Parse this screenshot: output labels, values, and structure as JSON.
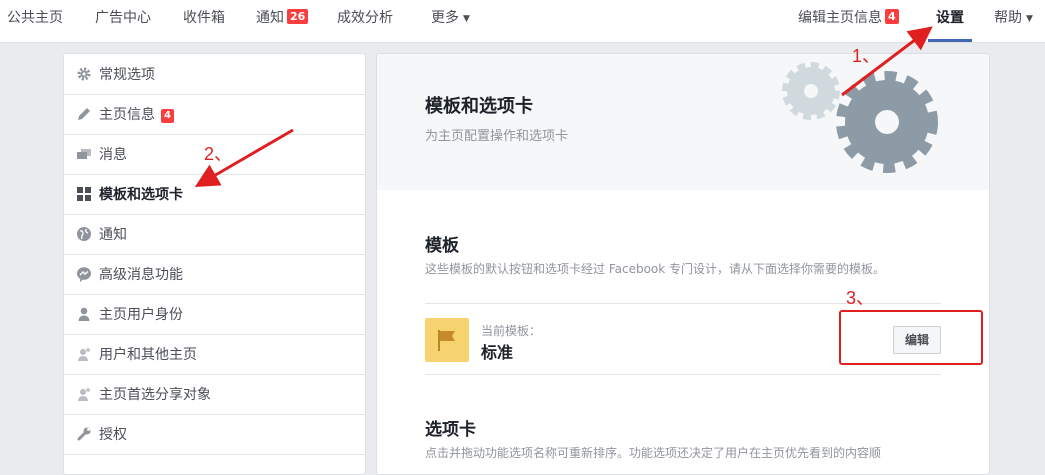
{
  "topnav": {
    "items": [
      {
        "label": "公共主页"
      },
      {
        "label": "广告中心"
      },
      {
        "label": "收件箱"
      },
      {
        "label": "通知",
        "badge": "26"
      },
      {
        "label": "成效分析"
      },
      {
        "label": "更多"
      }
    ],
    "right": [
      {
        "label": "编辑主页信息",
        "badge": "4"
      },
      {
        "label": "设置"
      },
      {
        "label": "帮助"
      }
    ],
    "active": "设置"
  },
  "sidebar": {
    "items": [
      {
        "label": "常规选项",
        "icon": "gear-icon"
      },
      {
        "label": "主页信息",
        "icon": "pencil-icon",
        "badge": "4"
      },
      {
        "label": "消息",
        "icon": "messages-icon"
      },
      {
        "label": "模板和选项卡",
        "icon": "grid-icon",
        "active": true
      },
      {
        "label": "通知",
        "icon": "globe-icon"
      },
      {
        "label": "高级消息功能",
        "icon": "messenger-icon"
      },
      {
        "label": "主页用户身份",
        "icon": "person-icon"
      },
      {
        "label": "用户和其他主页",
        "icon": "person-star-icon"
      },
      {
        "label": "主页首选分享对象",
        "icon": "person-star-icon"
      },
      {
        "label": "授权",
        "icon": "wrench-icon"
      }
    ]
  },
  "main": {
    "title": "模板和选项卡",
    "subtitle": "为主页配置操作和选项卡",
    "template_section": {
      "title": "模板",
      "description": "这些模板的默认按钮和选项卡经过 Facebook 专门设计，请从下面选择你需要的模板。",
      "current_label": "当前模板：",
      "current_value": "标准",
      "edit_label": "编辑"
    },
    "tabs_section": {
      "title": "选项卡",
      "description": "点击并拖动功能选项名称可重新排序。功能选项还决定了用户在主页优先看到的内容顺"
    }
  },
  "annotations": {
    "step1": "1、",
    "step2": "2、",
    "step3": "3、"
  },
  "colors": {
    "accent": "#4267b2",
    "badge": "#fa3e3e",
    "annotation": "#e02020",
    "template_icon": "#f7d36f"
  }
}
